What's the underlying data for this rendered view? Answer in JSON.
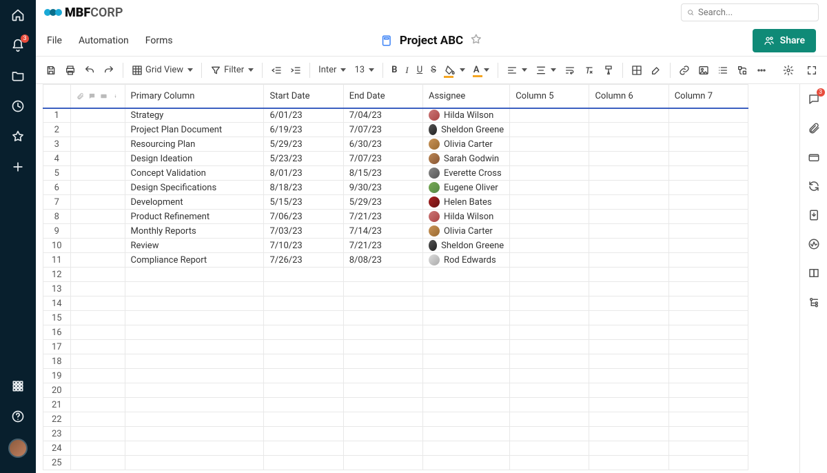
{
  "brand": {
    "name_prefix": "MBF",
    "name_suffix": "CORP"
  },
  "search": {
    "placeholder": "Search..."
  },
  "menus": [
    "File",
    "Automation",
    "Forms"
  ],
  "document": {
    "title": "Project ABC"
  },
  "share": {
    "label": "Share"
  },
  "toolbar": {
    "grid_view": "Grid View",
    "filter": "Filter",
    "font": "Inter",
    "font_size": "13"
  },
  "left_rail": {
    "notifications_badge": "3"
  },
  "right_rail": {
    "comments_badge": "3"
  },
  "columns": [
    {
      "key": "primary",
      "label": "Primary Column"
    },
    {
      "key": "start",
      "label": "Start Date"
    },
    {
      "key": "end",
      "label": "End Date"
    },
    {
      "key": "assignee",
      "label": "Assignee"
    },
    {
      "key": "c5",
      "label": "Column 5"
    },
    {
      "key": "c6",
      "label": "Column 6"
    },
    {
      "key": "c7",
      "label": "Column 7"
    }
  ],
  "rows": [
    {
      "n": "1",
      "primary": "Strategy",
      "start": "6/01/23",
      "end": "7/04/23",
      "assignee": "Hilda Wilson",
      "av": "c0"
    },
    {
      "n": "2",
      "primary": "Project Plan Document",
      "start": "6/19/23",
      "end": "7/07/23",
      "assignee": "Sheldon Greene",
      "av": "c1"
    },
    {
      "n": "3",
      "primary": "Resourcing Plan",
      "start": "5/29/23",
      "end": "6/30/23",
      "assignee": "Olivia Carter",
      "av": "c2"
    },
    {
      "n": "4",
      "primary": "Design Ideation",
      "start": "5/23/23",
      "end": "7/07/23",
      "assignee": "Sarah Godwin",
      "av": "c3"
    },
    {
      "n": "5",
      "primary": "Concept Validation",
      "start": "8/01/23",
      "end": "8/15/23",
      "assignee": "Everette Cross",
      "av": "c4"
    },
    {
      "n": "6",
      "primary": "Design Specifications",
      "start": "8/18/23",
      "end": "9/30/23",
      "assignee": "Eugene Oliver",
      "av": "c5"
    },
    {
      "n": "7",
      "primary": "Development",
      "start": "5/15/23",
      "end": "5/29/23",
      "assignee": "Helen Bates",
      "av": "c6"
    },
    {
      "n": "8",
      "primary": "Product Refinement",
      "start": "7/06/23",
      "end": "7/21/23",
      "assignee": "Hilda Wilson",
      "av": "c0"
    },
    {
      "n": "9",
      "primary": "Monthly Reports",
      "start": "7/03/23",
      "end": "7/14/23",
      "assignee": "Olivia Carter",
      "av": "c2"
    },
    {
      "n": "10",
      "primary": "Review",
      "start": "7/10/23",
      "end": "7/21/23",
      "assignee": "Sheldon Greene",
      "av": "c1"
    },
    {
      "n": "11",
      "primary": "Compliance Report",
      "start": "7/26/23",
      "end": "8/08/23",
      "assignee": "Rod Edwards",
      "av": "c7"
    }
  ],
  "empty_row_count": 14
}
